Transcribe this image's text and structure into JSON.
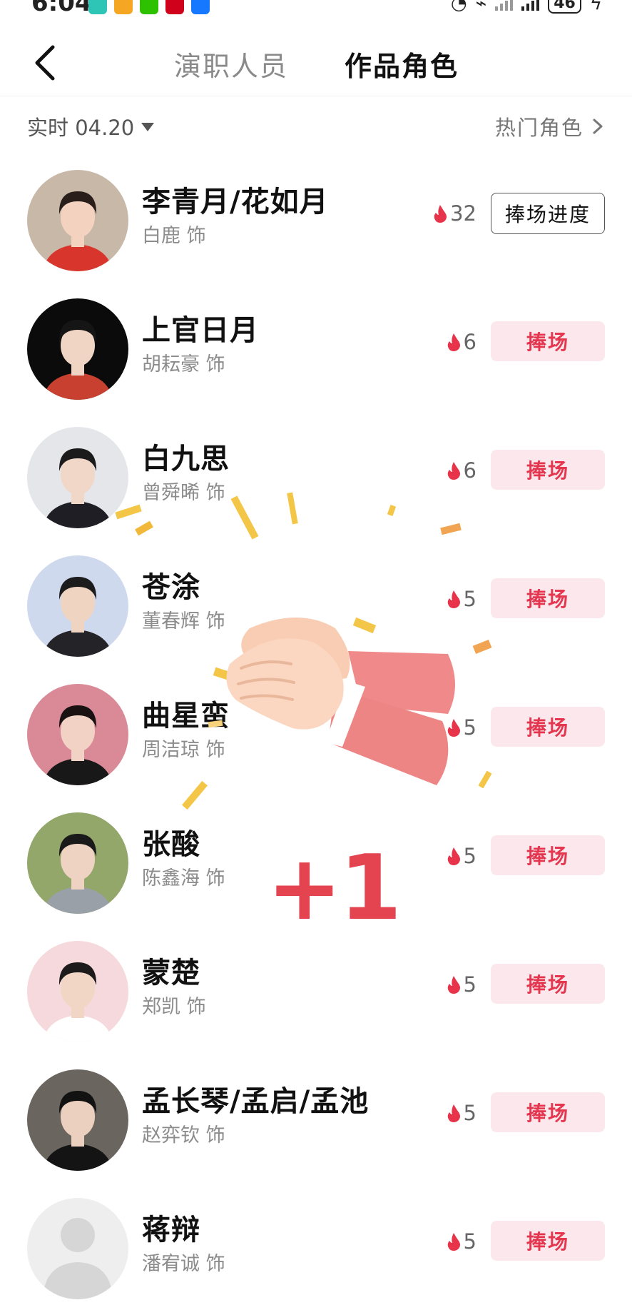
{
  "status_bar": {
    "time": "6:04",
    "battery": "46",
    "app_icons": [
      {
        "icon": "app-icon",
        "color": "#2ec4b6"
      },
      {
        "icon": "weibo-icon",
        "color": "#f5a623"
      },
      {
        "icon": "wechat-icon",
        "color": "#2dc100"
      },
      {
        "icon": "red-app-icon",
        "color": "#d0021b"
      },
      {
        "icon": "alipay-icon",
        "color": "#1677ff"
      }
    ]
  },
  "header": {
    "tabs": [
      {
        "label": "演职人员",
        "active": false
      },
      {
        "label": "作品角色",
        "active": true
      }
    ]
  },
  "filter": {
    "date_label": "实时 04.20",
    "hot_roles_label": "热门角色"
  },
  "roles": [
    {
      "name": "李青月/花如月",
      "actor": "白鹿 饰",
      "heat": "32",
      "button": "捧场进度",
      "button_style": "outline",
      "avatar": {
        "bg": "#c8b8a8",
        "skin": "#f3d3c0",
        "hair": "#2a1e1a",
        "cloth": "#d8362d"
      }
    },
    {
      "name": "上官日月",
      "actor": "胡耘豪 饰",
      "heat": "6",
      "button": "捧场",
      "button_style": "filled",
      "avatar": {
        "bg": "#0b0b0b",
        "skin": "#f0d5c5",
        "hair": "#151515",
        "cloth": "#c8402f"
      }
    },
    {
      "name": "白九思",
      "actor": "曾舜晞 饰",
      "heat": "6",
      "button": "捧场",
      "button_style": "filled",
      "avatar": {
        "bg": "#e4e6ea",
        "skin": "#f1d7c7",
        "hair": "#1b1b1b",
        "cloth": "#1e1e24"
      }
    },
    {
      "name": "苍涂",
      "actor": "董春辉 饰",
      "heat": "5",
      "button": "捧场",
      "button_style": "filled",
      "avatar": {
        "bg": "#cfd9ee",
        "skin": "#efd4c2",
        "hair": "#1c1c1c",
        "cloth": "#232328"
      }
    },
    {
      "name": "曲星蛮",
      "actor": "周洁琼 饰",
      "heat": "5",
      "button": "捧场",
      "button_style": "filled",
      "avatar": {
        "bg": "#d98a96",
        "skin": "#f2d2c4",
        "hair": "#1a1212",
        "cloth": "#181818"
      }
    },
    {
      "name": "张酸",
      "actor": "陈鑫海 饰",
      "heat": "5",
      "button": "捧场",
      "button_style": "filled",
      "avatar": {
        "bg": "#93a76a",
        "skin": "#efd3c2",
        "hair": "#1a1a1a",
        "cloth": "#9aa0a8"
      }
    },
    {
      "name": "蒙楚",
      "actor": "郑凯 饰",
      "heat": "5",
      "button": "捧场",
      "button_style": "filled",
      "avatar": {
        "bg": "#f6d9dc",
        "skin": "#f1d6c6",
        "hair": "#1c1a1a",
        "cloth": "#ffffff"
      }
    },
    {
      "name": "孟长琴/孟启/孟池",
      "actor": "赵弈钦 饰",
      "heat": "5",
      "button": "捧场",
      "button_style": "filled",
      "avatar": {
        "bg": "#6b6560",
        "skin": "#ecd0bf",
        "hair": "#121212",
        "cloth": "#141414"
      }
    },
    {
      "name": "蒋辩",
      "actor": "潘宥诚 饰",
      "heat": "5",
      "button": "捧场",
      "button_style": "filled",
      "avatar": {
        "bg": "#eeeeee",
        "placeholder": true
      }
    }
  ],
  "celebration": {
    "plus_text": "+1",
    "accent": "#e34450",
    "icon": "clapping-hands-icon"
  },
  "colors": {
    "cheer_bg": "#fce8ec",
    "cheer_text": "#e5364f",
    "flame": "#e8344a"
  }
}
